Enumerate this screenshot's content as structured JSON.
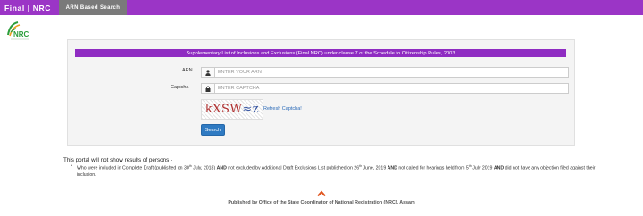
{
  "header": {
    "brand": "Final | NRC",
    "active_tab": "ARN Based Search"
  },
  "logo": {
    "text": "NRC"
  },
  "form": {
    "banner": "Supplementary List of Inclusions and Exclusions (Final NRC) under clause 7 of the Schedule to Citizenship Rules, 2003",
    "arn_label": "ARN",
    "arn_placeholder": "ENTER YOUR ARN",
    "captcha_label": "Captcha",
    "captcha_placeholder": "ENTER CAPTCHA",
    "captcha_text_a": "kXSW",
    "captcha_text_b": "≈z",
    "refresh_label": "Refresh Captcha!",
    "search_label": "Search"
  },
  "notice": {
    "title": "This portal will not show results of persons -",
    "p1": "Who were included in Complete Draft (published on 30",
    "sup1": "th",
    "p2": " July, 2018) ",
    "and1": "AND",
    "p3": " not excluded by Additional Draft Exclusions List published on 26",
    "sup2": "th",
    "p4": " June, 2019 ",
    "and2": "AND",
    "p5": " not called for hearings held from 5",
    "sup3": "th",
    "p6": " July 2019 ",
    "and3": "AND",
    "p7": " did not have any objection filed against their inclusion."
  },
  "footer": {
    "text": "Published by Office of the State Coordinator of National Registration (NRC), Assam"
  },
  "colors": {
    "topbar": "#9b35c6",
    "tab": "#7a7a7a",
    "banner": "#8f2cc2",
    "button": "#2f7ac2",
    "scroll_top": "#e0531c"
  }
}
